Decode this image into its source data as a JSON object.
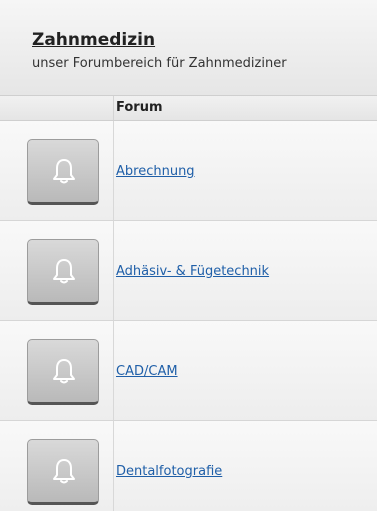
{
  "header": {
    "title": "Zahnmedizin",
    "subtitle": "unser Forumbereich für Zahnmediziner"
  },
  "table": {
    "column_forum": "Forum"
  },
  "forums": [
    {
      "label": "Abrechnung",
      "icon": "bell-icon"
    },
    {
      "label": "Adhäsiv- & Fügetechnik",
      "icon": "bell-icon"
    },
    {
      "label": "CAD/CAM",
      "icon": "bell-icon"
    },
    {
      "label": "Dentalfotografie",
      "icon": "bell-icon"
    }
  ],
  "colors": {
    "link": "#1f5fa8",
    "button_bg": "#c8c8c8",
    "header_bg": "#efefef"
  }
}
